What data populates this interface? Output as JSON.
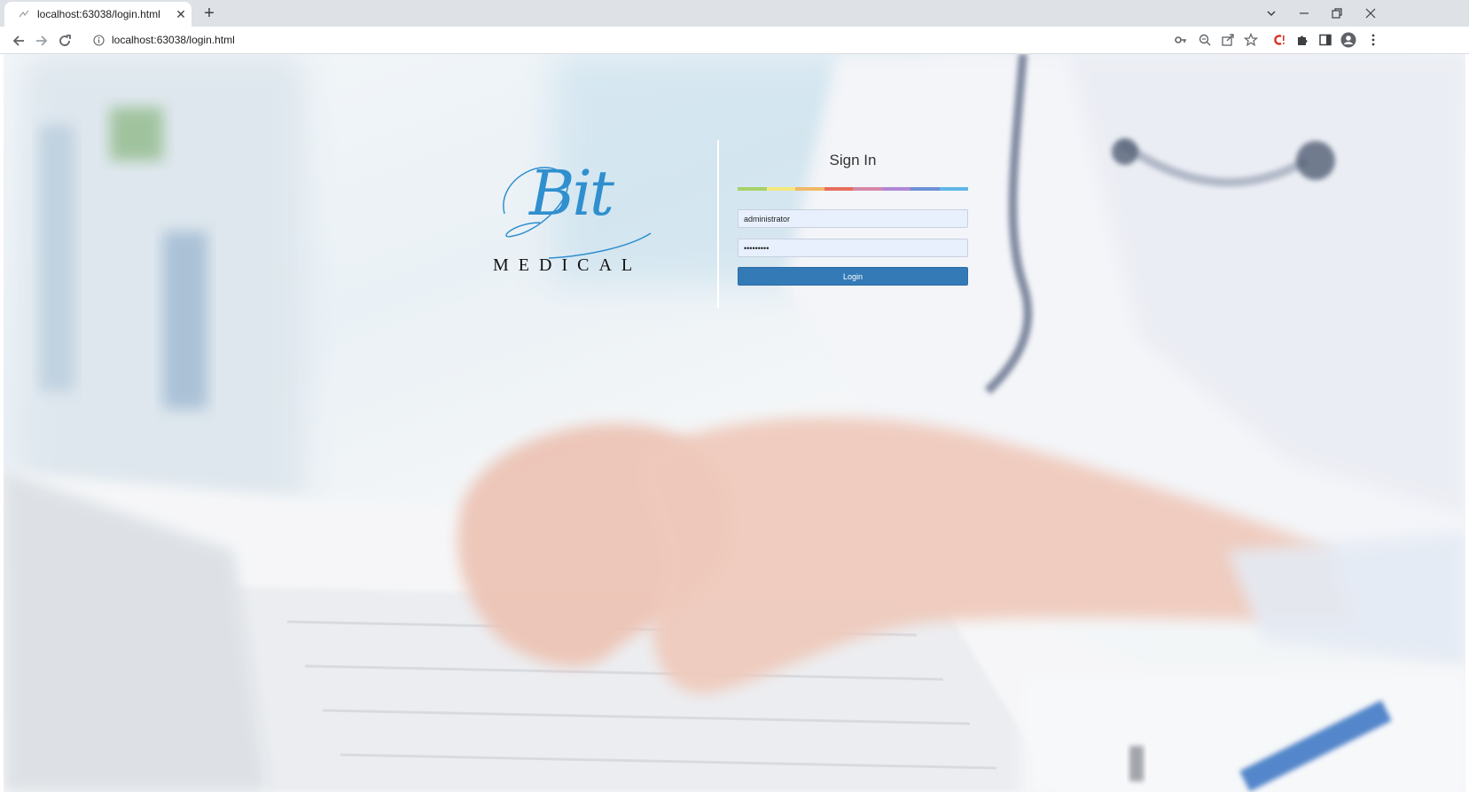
{
  "browser": {
    "tab_title": "localhost:63038/login.html",
    "url": "localhost:63038/login.html",
    "icons": [
      "back-icon",
      "forward-icon",
      "reload-icon",
      "info-icon",
      "key-icon",
      "zoom-icon",
      "share-icon",
      "star-icon",
      "extension-c-icon",
      "puzzle-icon",
      "sidepanel-icon",
      "profile-icon",
      "menu-icon",
      "minimize-icon",
      "restore-icon",
      "close-window-icon",
      "tab-search-icon"
    ]
  },
  "brand": {
    "script": "Bit",
    "word": "MEDICAL",
    "color": "#2f8fcf"
  },
  "login": {
    "title": "Sign In",
    "username_value": "administrator",
    "password_value": "•••••••••",
    "button_label": "Login",
    "button_color": "#337ab7",
    "stripe_colors": [
      "#a6d26a",
      "#f3e97d",
      "#f2b766",
      "#e86d5e",
      "#d587a8",
      "#b086d4",
      "#6e8fd4",
      "#5fb6e6"
    ]
  }
}
